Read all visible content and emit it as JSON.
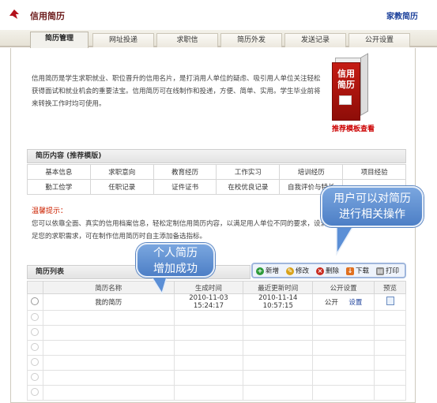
{
  "header": {
    "title": "信用简历",
    "right_link": "家教简历"
  },
  "tabs": [
    "简历管理",
    "网址投递",
    "求职信",
    "简历外发",
    "发送记录",
    "公开设置"
  ],
  "intro": "信用简历是学生求职就业、职位晋升的信用名片，是打消用人单位的疑虑、吸引用人单位关注轻松获得面试和就业机会的重要法宝。信用简历可在线制作和投递，方便、简单、实用。学生毕业前将来转换工作时均可使用。",
  "book": {
    "text": "信用简历",
    "recommend": "推荐模板查看"
  },
  "content_section": {
    "title": "简历内容 (推荐模版)",
    "items": [
      "基本信息",
      "求职意向",
      "教育经历",
      "工作实习",
      "培训经历",
      "项目经验",
      "勤工俭学",
      "任职记录",
      "证件证书",
      "在校优良记录",
      "自我评价与特长",
      ""
    ]
  },
  "tip": {
    "title": "温馨提示：",
    "text": "您可以依靠全面、真实的信用档案信息，轻松定制信用简历内容，以满足用人单位不同的要求，设满足您的求职需求，可在制作信用简历时自主添加备选指标。"
  },
  "list": {
    "title": "简历列表",
    "toolbar": [
      "新增",
      "修改",
      "删除",
      "下载",
      "打印"
    ],
    "columns": [
      "",
      "简历名称",
      "生成时间",
      "最近更新时间",
      "公开设置",
      "预览"
    ],
    "rows": [
      {
        "name": "我的简历",
        "created": "2010-11-03 15:24:17",
        "updated": "2010-11-14 10:57:15",
        "public": "公开",
        "settings": "设置"
      }
    ]
  },
  "callouts": {
    "success": "个人简历\n增加成功",
    "operate": "用户可以对简历\n进行相关操作"
  },
  "colors": {
    "accent_red": "#cc0000",
    "link_blue": "#1a3f9a",
    "callout_blue": "#5b8fd6"
  }
}
